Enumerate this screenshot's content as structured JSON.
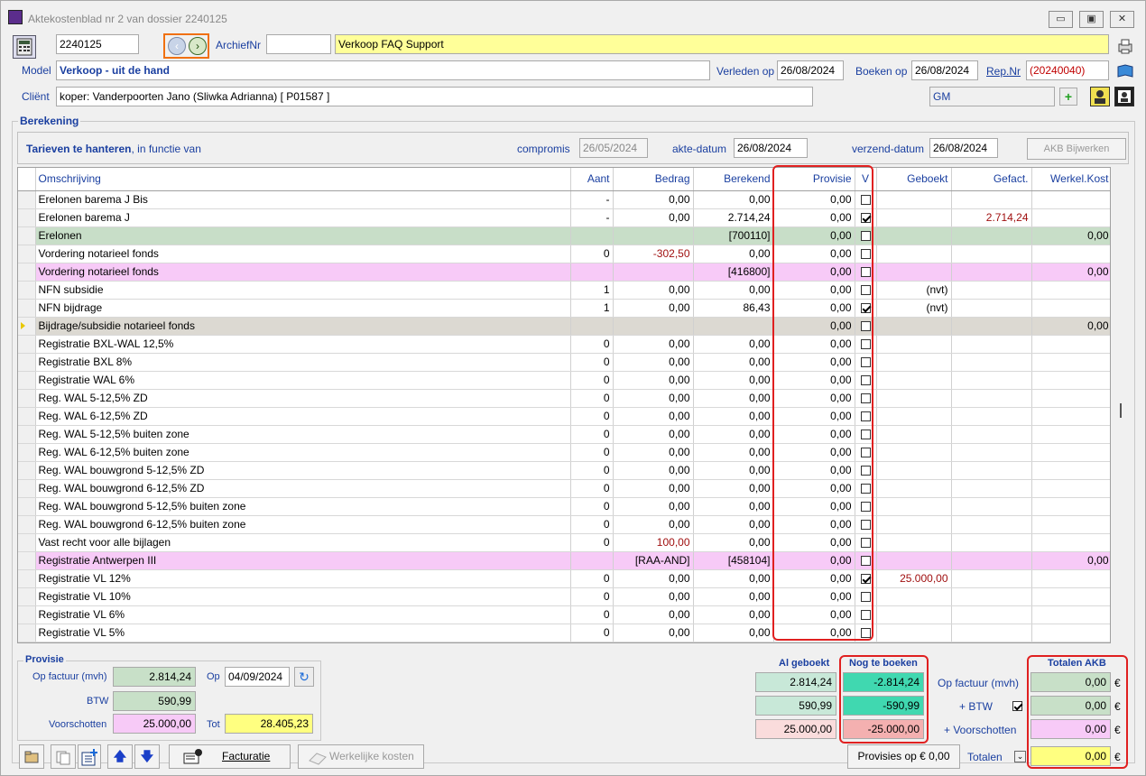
{
  "window": {
    "title": "Aktekostenblad nr 2 van dossier 2240125",
    "btn_min": "▭",
    "btn_max": "▣",
    "btn_close": "✕"
  },
  "header": {
    "dossier": "2240125",
    "archief_label": "ArchiefNr",
    "archief_value": "",
    "subject": "Verkoop FAQ Support",
    "model_label": "Model",
    "model_value": "Verkoop - uit de hand",
    "verleden_label": "Verleden op",
    "verleden_value": "26/08/2024",
    "boeken_label": "Boeken op",
    "boeken_value": "26/08/2024",
    "rep_label": "Rep.Nr",
    "rep_value": "(20240040)",
    "client_label": "Cliënt",
    "client_value": "koper: Vanderpoorten Jano (Sliwka Adrianna) [ P01587 ]",
    "gm_value": "GM"
  },
  "berekening": {
    "title": "Berekening",
    "tarieven": "Tarieven te hanteren",
    "tarieven_suffix": ", in functie van",
    "compromis_label": "compromis",
    "compromis_value": "26/05/2024",
    "akte_label": "akte-datum",
    "akte_value": "26/08/2024",
    "verzend_label": "verzend-datum",
    "verzend_value": "26/08/2024",
    "akb_button": "AKB Bijwerken"
  },
  "table": {
    "columns": [
      "Omschrijving",
      "Aant",
      "Bedrag",
      "Berekend",
      "Provisie",
      "V",
      "Geboekt",
      "Gefact.",
      "Werkel.Kost"
    ],
    "rows": [
      {
        "type": "normal",
        "o": "Erelonen barema J Bis",
        "a": "-",
        "b": "0,00",
        "be": "0,00",
        "p": "0,00",
        "v": false,
        "g": "",
        "gf": "",
        "w": ""
      },
      {
        "type": "normal",
        "o": "Erelonen barema J",
        "a": "-",
        "b": "0,00",
        "be": "2.714,24",
        "p": "0,00",
        "v": true,
        "g": "",
        "gf": "2.714,24",
        "w": ""
      },
      {
        "type": "green",
        "o": "Erelonen",
        "a": "",
        "b": "",
        "be": "[700110]",
        "p": "0,00",
        "v": false,
        "g": "",
        "gf": "",
        "w": "0,00"
      },
      {
        "type": "normal",
        "o": "Vordering notarieel fonds",
        "a": "0",
        "b": "-302,50",
        "be": "0,00",
        "p": "0,00",
        "v": false,
        "g": "",
        "gf": "",
        "w": ""
      },
      {
        "type": "pink",
        "o": "Vordering notarieel fonds",
        "a": "",
        "b": "",
        "be": "[416800]",
        "p": "0,00",
        "v": false,
        "g": "",
        "gf": "",
        "w": "0,00"
      },
      {
        "type": "normal",
        "o": "NFN subsidie",
        "a": "1",
        "b": "0,00",
        "be": "0,00",
        "p": "0,00",
        "v": false,
        "g": "(nvt)",
        "gf": "",
        "w": ""
      },
      {
        "type": "normal",
        "o": "NFN bijdrage",
        "a": "1",
        "b": "0,00",
        "be": "86,43",
        "p": "0,00",
        "v": true,
        "g": "(nvt)",
        "gf": "",
        "w": ""
      },
      {
        "type": "gray",
        "o": "Bijdrage/subsidie notarieel fonds",
        "a": "",
        "b": "",
        "be": "",
        "p": "0,00",
        "v": false,
        "g": "",
        "gf": "",
        "w": "0,00"
      },
      {
        "type": "normal",
        "o": "Registratie BXL-WAL 12,5%",
        "a": "0",
        "b": "0,00",
        "be": "0,00",
        "p": "0,00",
        "v": false,
        "g": "",
        "gf": "",
        "w": ""
      },
      {
        "type": "normal",
        "o": "Registratie BXL 8%",
        "a": "0",
        "b": "0,00",
        "be": "0,00",
        "p": "0,00",
        "v": false,
        "g": "",
        "gf": "",
        "w": ""
      },
      {
        "type": "normal",
        "o": "Registratie WAL 6%",
        "a": "0",
        "b": "0,00",
        "be": "0,00",
        "p": "0,00",
        "v": false,
        "g": "",
        "gf": "",
        "w": ""
      },
      {
        "type": "normal",
        "o": "Reg. WAL 5-12,5% ZD",
        "a": "0",
        "b": "0,00",
        "be": "0,00",
        "p": "0,00",
        "v": false,
        "g": "",
        "gf": "",
        "w": ""
      },
      {
        "type": "normal",
        "o": "Reg. WAL 6-12,5% ZD",
        "a": "0",
        "b": "0,00",
        "be": "0,00",
        "p": "0,00",
        "v": false,
        "g": "",
        "gf": "",
        "w": ""
      },
      {
        "type": "normal",
        "o": "Reg. WAL 5-12,5% buiten zone",
        "a": "0",
        "b": "0,00",
        "be": "0,00",
        "p": "0,00",
        "v": false,
        "g": "",
        "gf": "",
        "w": ""
      },
      {
        "type": "normal",
        "o": "Reg. WAL 6-12,5% buiten zone",
        "a": "0",
        "b": "0,00",
        "be": "0,00",
        "p": "0,00",
        "v": false,
        "g": "",
        "gf": "",
        "w": ""
      },
      {
        "type": "normal",
        "o": "Reg. WAL bouwgrond 5-12,5% ZD",
        "a": "0",
        "b": "0,00",
        "be": "0,00",
        "p": "0,00",
        "v": false,
        "g": "",
        "gf": "",
        "w": ""
      },
      {
        "type": "normal",
        "o": "Reg. WAL bouwgrond 6-12,5% ZD",
        "a": "0",
        "b": "0,00",
        "be": "0,00",
        "p": "0,00",
        "v": false,
        "g": "",
        "gf": "",
        "w": ""
      },
      {
        "type": "normal",
        "o": "Reg. WAL bouwgrond 5-12,5% buiten zone",
        "a": "0",
        "b": "0,00",
        "be": "0,00",
        "p": "0,00",
        "v": false,
        "g": "",
        "gf": "",
        "w": ""
      },
      {
        "type": "normal",
        "o": "Reg. WAL bouwgrond 6-12,5% buiten zone",
        "a": "0",
        "b": "0,00",
        "be": "0,00",
        "p": "0,00",
        "v": false,
        "g": "",
        "gf": "",
        "w": ""
      },
      {
        "type": "normal",
        "o": "Vast recht voor alle bijlagen",
        "a": "0",
        "b": "100,00",
        "be": "0,00",
        "p": "0,00",
        "v": false,
        "g": "",
        "gf": "",
        "w": ""
      },
      {
        "type": "pink",
        "o": "Registratie Antwerpen III",
        "a": "",
        "b": "[RAA-AND]",
        "be": "[458104]",
        "p": "0,00",
        "v": false,
        "g": "",
        "gf": "",
        "w": "0,00"
      },
      {
        "type": "normal",
        "o": "Registratie VL 12%",
        "a": "0",
        "b": "0,00",
        "be": "0,00",
        "p": "0,00",
        "v": true,
        "g": "25.000,00",
        "gf": "",
        "w": ""
      },
      {
        "type": "normal",
        "o": "Registratie VL 10%",
        "a": "0",
        "b": "0,00",
        "be": "0,00",
        "p": "0,00",
        "v": false,
        "g": "",
        "gf": "",
        "w": ""
      },
      {
        "type": "normal",
        "o": "Registratie VL 6%",
        "a": "0",
        "b": "0,00",
        "be": "0,00",
        "p": "0,00",
        "v": false,
        "g": "",
        "gf": "",
        "w": ""
      },
      {
        "type": "normal",
        "o": "Registratie VL 5%",
        "a": "0",
        "b": "0,00",
        "be": "0,00",
        "p": "0,00",
        "v": false,
        "g": "",
        "gf": "",
        "w": ""
      }
    ]
  },
  "provisie": {
    "title": "Provisie",
    "factuur_label": "Op factuur (mvh)",
    "factuur_value": "2.814,24",
    "btw_label": "BTW",
    "btw_value": "590,99",
    "voorschot_label": "Voorschotten",
    "voorschot_value": "25.000,00",
    "op_label": "Op",
    "op_value": "04/09/2024",
    "tot_label": "Tot",
    "tot_value": "28.405,23"
  },
  "totals": {
    "al_geboekt": "Al geboekt",
    "nog_te_boeken": "Nog te boeken",
    "totalen_akb": "Totalen AKB",
    "ag": [
      "2.814,24",
      "590,99",
      "25.000,00"
    ],
    "ntb": [
      "-2.814,24",
      "-590,99",
      "-25.000,00"
    ],
    "labels": [
      "Op factuur (mvh)",
      "+ BTW",
      "+ Voorschotten"
    ],
    "akb": [
      "0,00",
      "0,00",
      "0,00"
    ],
    "euro": "€",
    "totalen_label": "Totalen",
    "totalen_value": "0,00",
    "provisies_button": "Provisies op € 0,00"
  },
  "toolbar": {
    "facturatie": "Facturatie",
    "werkelijke": "Werkelijke kosten"
  }
}
